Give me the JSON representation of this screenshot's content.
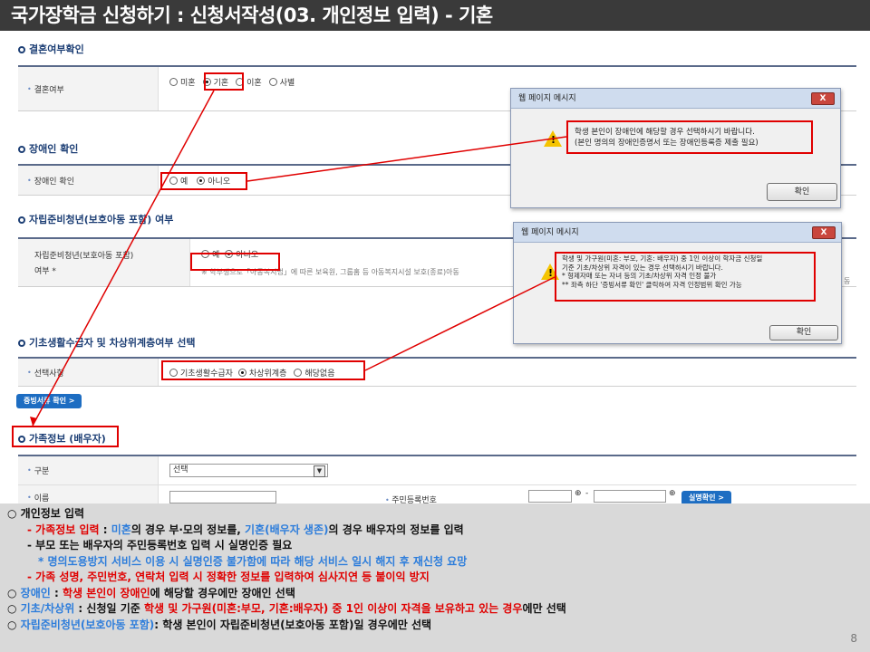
{
  "page": {
    "title": "국가장학금 신청하기 : 신청서작성(03. 개인정보 입력) - 기혼",
    "page_number": "8"
  },
  "marriage": {
    "section_title": "결혼여부확인",
    "label": "결혼여부",
    "options": [
      "미혼",
      "기혼",
      "이혼",
      "사별"
    ],
    "selected": "기혼"
  },
  "disability": {
    "section_title": "장애인 확인",
    "label": "장애인 확인",
    "options": [
      "예",
      "아니오"
    ],
    "selected": "아니오"
  },
  "youth": {
    "section_title": "자립준비청년(보호아동 포함) 여부",
    "label_line1": "자립준비청년(보호아동 포함)",
    "label_line2": "여부 *",
    "options": [
      "예",
      "아니오"
    ],
    "selected": "아니오",
    "note": "※ 학부생으로「아동복지법」에 따른 보육원, 그룹홈 등 아동복지시설 보호(종료)아동",
    "note_tail": "동"
  },
  "basic": {
    "section_title": "기초생활수급자 및 차상위계층여부 선택",
    "label": "선택사항",
    "options": [
      "기초생활수급자",
      "차상위계층",
      "해당없음"
    ],
    "selected": "차상위계층",
    "doc_button": "증빙서류 확인 >"
  },
  "family": {
    "section_title": "가족정보 (배우자)",
    "type_label": "구분",
    "type_value": "선택",
    "name_label": "이름",
    "rrn_label": "주민등록번호",
    "rrn_dash": "-",
    "verify_button": "실명확인 >"
  },
  "dialog1": {
    "title": "웹 페이지 메시지",
    "close": "X",
    "line1": "학생 본인이 장애인에 해당할 경우 선택하시기 바랍니다.",
    "line2": "(본인 명의의 장애인증명서 또는 장애인등록증 제출 필요)",
    "ok": "확인"
  },
  "dialog2": {
    "title": "웹 페이지 메시지",
    "close": "X",
    "line1": "학생 및 가구원(미혼: 부모, 기혼: 배우자) 중 1인 이상이 학자금 신청일",
    "line2": "기준 기초/차상위 자격이 있는 경우 선택하시기 바랍니다.",
    "line3": "* 형제자매 또는 자녀 등의 기초/차상위 자격 인정 불가",
    "line4": "** 좌측 하단 '증빙서류 확인' 클릭하여 자격 인정범위 확인 가능",
    "ok": "확인"
  },
  "notes": {
    "n1": "○ 개인정보 입력",
    "n2_a": "- 가족정보 입력 ",
    "n2_b": ": ",
    "n2_c": "미혼",
    "n2_d": "의 경우 부·모의 정보를, ",
    "n2_e": "기혼(배우자 생존)",
    "n2_f": "의 경우 배우자의 정보를 입력",
    "n3": "- 부모 또는 배우자의 주민등록번호 입력 시 실명인증 필요",
    "n4": "* 명의도용방지 서비스 이용 시 실명인증 불가함에 따라 해당 서비스 일시 해지 후 재신청 요망",
    "n5": "- 가족 성명, 주민번호, 연락처 입력 시 정확한 정보를 입력하여 심사지연 등 불이익 방지",
    "n6_a": "○ ",
    "n6_b": "장애인",
    "n6_c": " : ",
    "n6_d": "학생 본인이 장애인",
    "n6_e": "에 해당할 경우에만 장애인 선택",
    "n7_a": "○ ",
    "n7_b": "기초/차상위",
    "n7_c": " : 신청일 기준 ",
    "n7_d": "학생 및 가구원(미혼:부모, 기혼:배우자) 중 1인 이상이 자격을 보유하고 있는 경우",
    "n7_e": "에만 선택",
    "n8_a": "○ ",
    "n8_b": "자립준비청년(보호아동 포함)",
    "n8_c": ": 학생 본인이 자립준비청년(보호아동 포함)일 경우에만 선택"
  },
  "colors": {
    "accent_red": "#e00000",
    "accent_blue": "#2d7ddb",
    "title_bg": "#3a3a3a"
  }
}
